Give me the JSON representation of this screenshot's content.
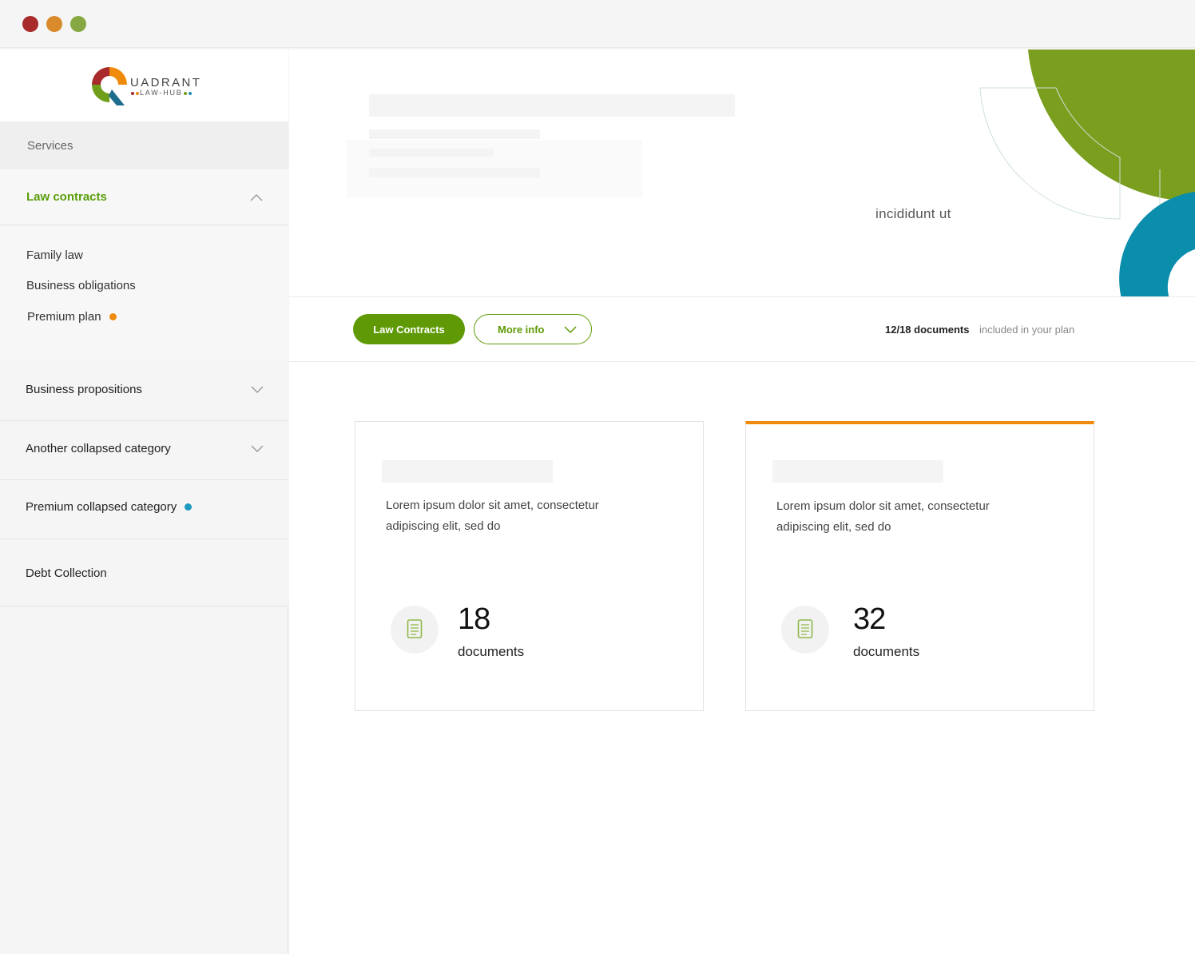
{
  "window": {
    "controls": [
      "close",
      "minimize",
      "maximize"
    ],
    "colors": {
      "close": "#a82a2a",
      "minimize": "#d98b2b",
      "maximize": "#86a843"
    }
  },
  "brand": {
    "name": "UADRANT",
    "sub": "LAW-HUB",
    "colors": [
      "#a82a2a",
      "#ef8a0a",
      "#6f9e1a",
      "#1f8fb0"
    ]
  },
  "sidebar": {
    "section_label": "Services",
    "open_category": {
      "label": "Law contracts",
      "items": [
        {
          "label": "Family law"
        },
        {
          "label": "Business obligations"
        },
        {
          "label": "Premium plan",
          "badge_color": "#ef8a0a"
        }
      ]
    },
    "categories": [
      {
        "label": "Business propositions",
        "collapsible": true
      },
      {
        "label": "Another collapsed category",
        "collapsible": true
      },
      {
        "label": "Premium collapsed category",
        "badge_color": "#1f9bc0"
      },
      {
        "label": "Debt Collection"
      }
    ]
  },
  "hero": {
    "text": "incididunt ut",
    "accent_green": "#7a9e1e",
    "accent_teal": "#0a8eac"
  },
  "toolbar": {
    "primary_label": "Law Contracts",
    "secondary_label": "More info",
    "docs_count": "12/18 documents",
    "docs_note": "included in your plan"
  },
  "cards": [
    {
      "description": "Lorem ipsum dolor sit amet, consectetur adipiscing elit, sed do",
      "count": "18",
      "count_label": "documents",
      "highlight": false
    },
    {
      "description": "Lorem ipsum dolor sit amet, consectetur adipiscing elit, sed do",
      "count": "32",
      "count_label": "documents",
      "highlight": true,
      "highlight_color": "#ef8a0a"
    }
  ],
  "colors": {
    "primary": "#5f9a06",
    "muted_text": "#888888"
  }
}
